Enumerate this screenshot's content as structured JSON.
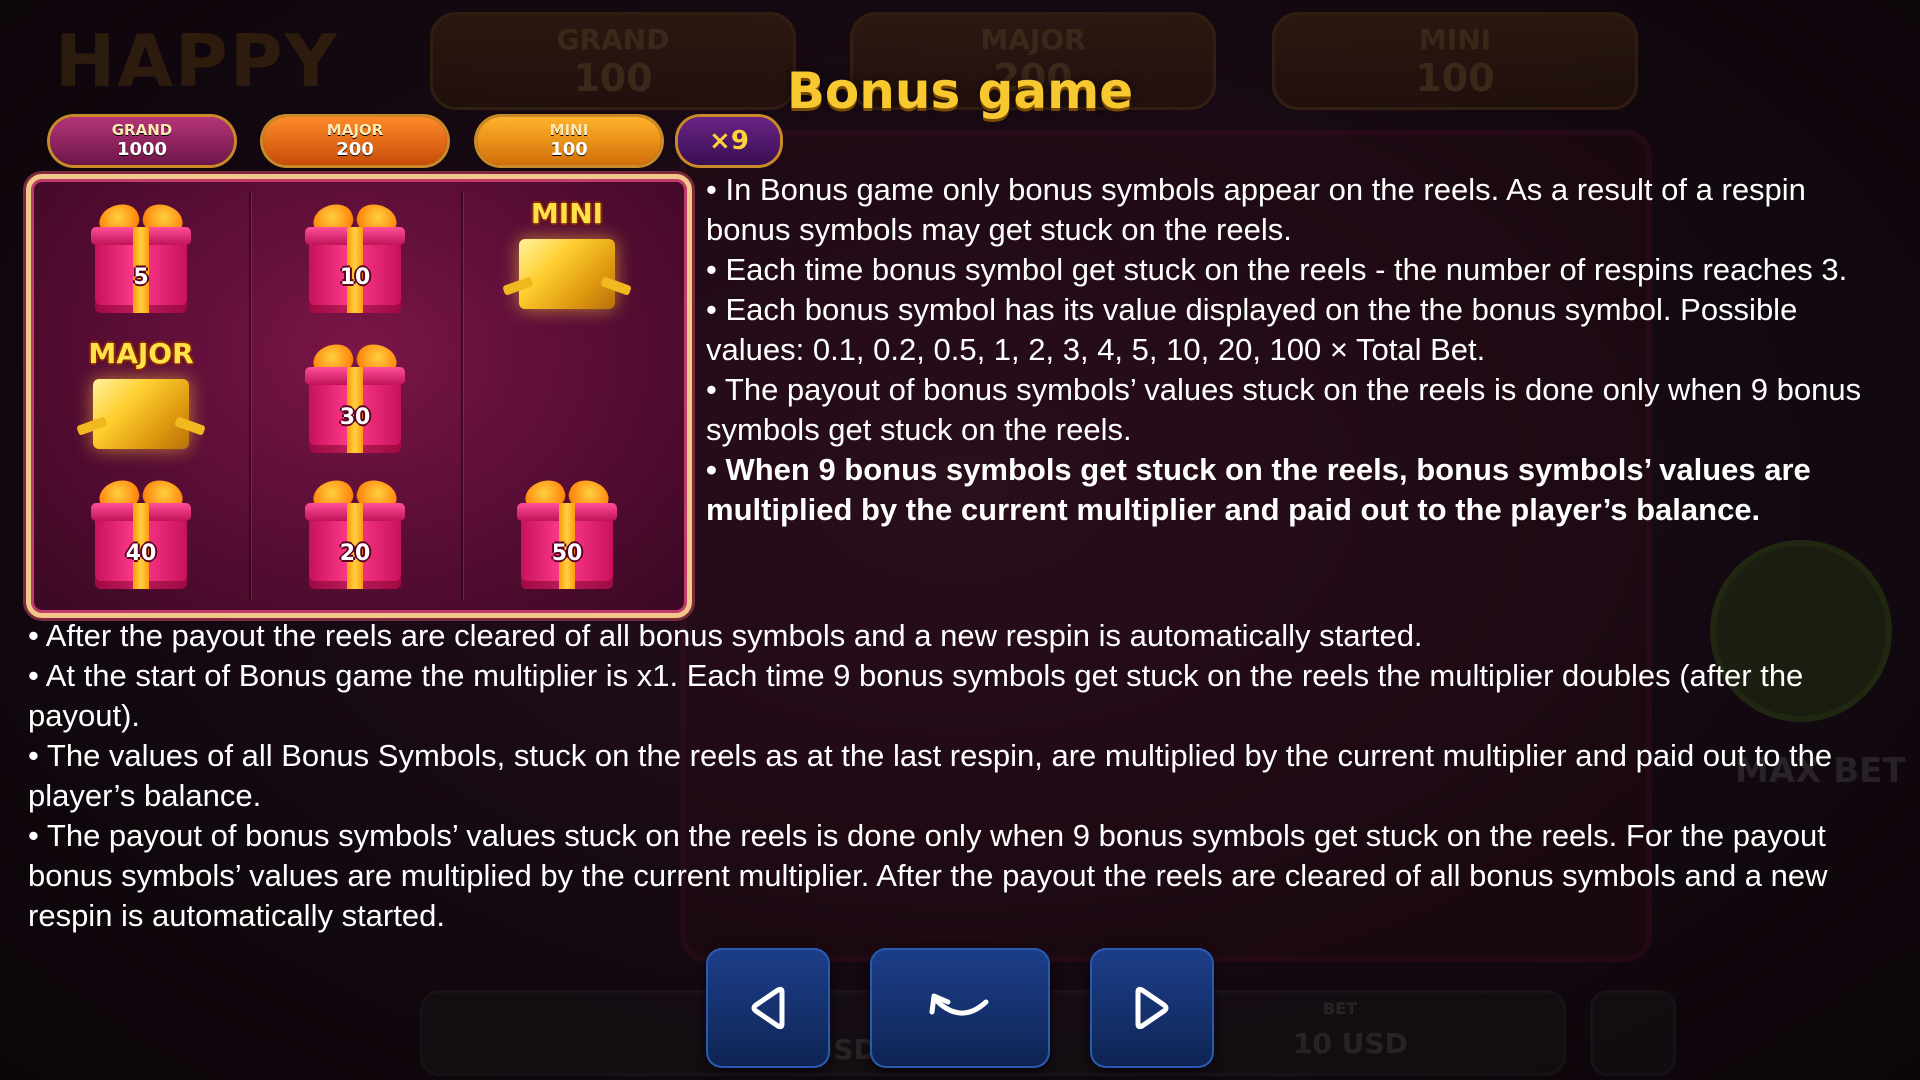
{
  "background": {
    "logo_text": "HAPPY",
    "jackpots": [
      {
        "name": "GRAND",
        "value": "100"
      },
      {
        "name": "MAJOR",
        "value": "200"
      },
      {
        "name": "MINI",
        "value": "100"
      }
    ],
    "max_bet_label": "MAX BET",
    "balance_value": "9985 USD",
    "bet_label": "BET",
    "bet_value": "10 USD"
  },
  "page": {
    "title": "Bonus game"
  },
  "jackpot_pills": {
    "grand": {
      "name": "GRAND",
      "value": "1000"
    },
    "major": {
      "name": "MAJOR",
      "value": "200"
    },
    "mini": {
      "name": "MINI",
      "value": "100"
    },
    "multiplier": "×9"
  },
  "reels": {
    "symbols": [
      {
        "type": "gift",
        "value": "5"
      },
      {
        "type": "gift",
        "value": "10"
      },
      {
        "type": "jackpot",
        "value": "MINI"
      },
      {
        "type": "jackpot",
        "value": "MAJOR"
      },
      {
        "type": "gift",
        "value": "30"
      },
      {
        "type": "empty",
        "value": ""
      },
      {
        "type": "gift",
        "value": "40"
      },
      {
        "type": "gift",
        "value": "20"
      },
      {
        "type": "gift",
        "value": "50"
      }
    ]
  },
  "rules": {
    "right": [
      "• In Bonus game only bonus symbols appear on the reels. As a result of a respin bonus symbols may get stuck on the reels.",
      "• Each time bonus symbol get stuck on the reels - the number of respins reaches 3.",
      "• Each bonus symbol has its value displayed on the the bonus symbol. Possible values: 0.1, 0.2, 0.5, 1, 2, 3, 4, 5, 10, 20, 100 × Total Bet.",
      "• The payout of bonus symbols’ values stuck on the reels is done only when 9 bonus symbols get stuck on the reels.",
      "• When 9 bonus symbols get stuck on the reels, bonus symbols’ values are multiplied by the current multiplier and paid out to the player’s balance."
    ],
    "bottom": [
      "• After the payout the reels are cleared of all bonus symbols and a new respin is automatically started.",
      "• At the start of Bonus game the multiplier is x1. Each time 9 bonus symbols get stuck on the reels the multiplier doubles (after the payout).",
      "• The values of all Bonus Symbols, stuck on the reels as at the last respin, are multiplied by the current multiplier and paid out to the player’s balance.",
      "• The payout of bonus symbols’ values stuck on the reels is done only when 9 bonus symbols get stuck on the reels. For the payout bonus symbols’ values are multiplied by the current multiplier. After the payout the reels are cleared of all bonus symbols and a new respin is automatically started."
    ]
  },
  "navigation": {
    "prev_icon": "triangle-left-icon",
    "back_icon": "return-arrow-icon",
    "next_icon": "triangle-right-icon",
    "accent": "#1c3f8a"
  },
  "colors": {
    "title": "#f7c830",
    "panel_border": "#f2c88a",
    "panel_bg": "#540c32"
  }
}
